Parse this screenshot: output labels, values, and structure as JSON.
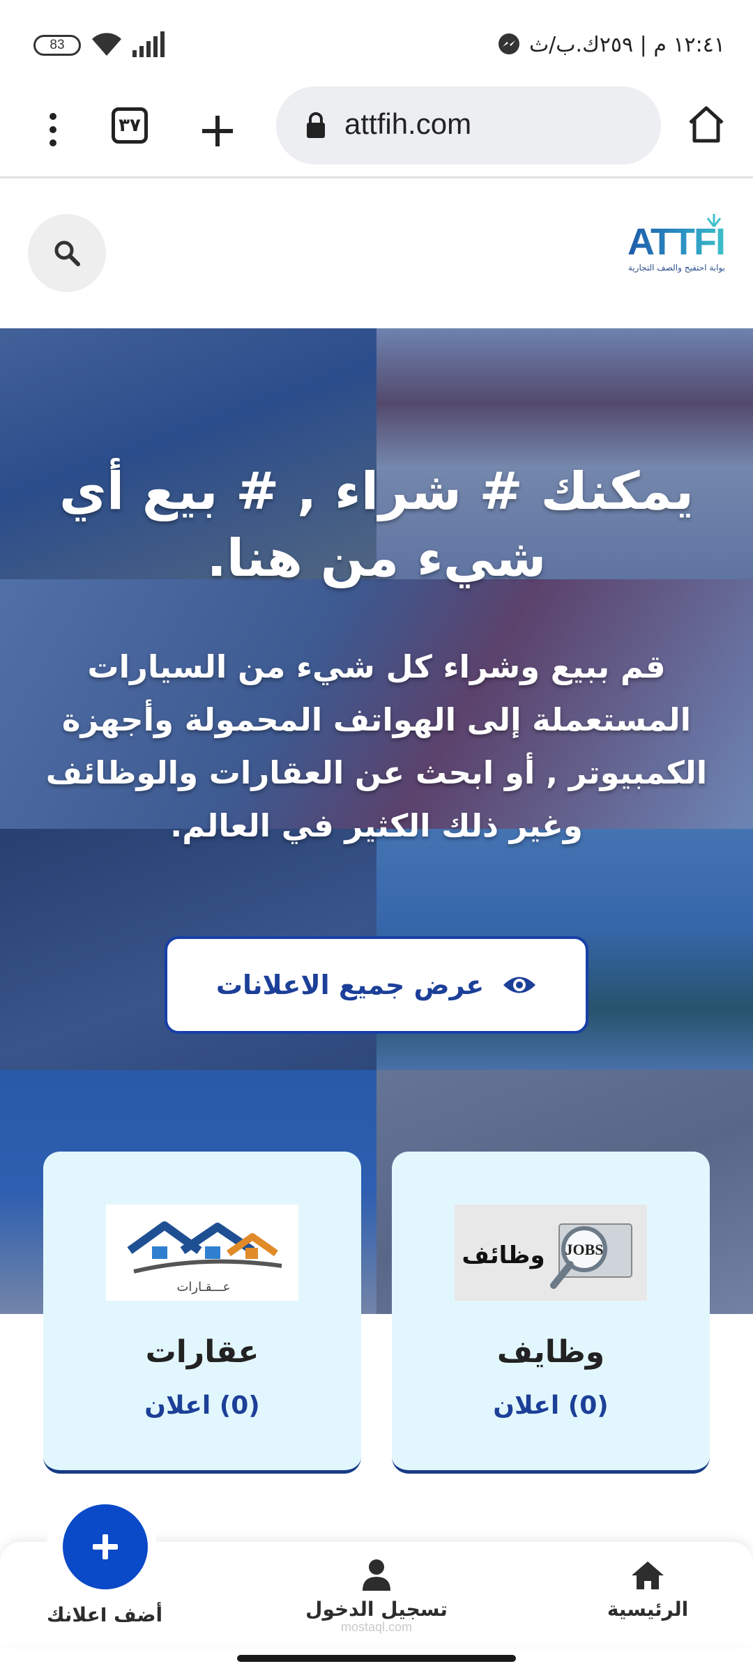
{
  "status_bar": {
    "time_text": "١٢:٤١ م | ٢٥٩ك.ب/ث",
    "battery": "83"
  },
  "browser": {
    "url": "attfih.com",
    "tab_count": "٣٧"
  },
  "site": {
    "logo_text": "ATTFIH",
    "logo_tagline": "بوابة احتفيح والصف التجارية"
  },
  "hero": {
    "title": "يمكنك # شراء , # بيع أي شيء من هنا.",
    "description": "قم ببيع وشراء كل شيء من السيارات المستعملة إلى الهواتف المحمولة وأجهزة الكمبيوتر , أو ابحث عن العقارات والوظائف وغير ذلك الكثير في العالم.",
    "cta_label": "عرض جميع الاعلانات"
  },
  "categories": [
    {
      "name": "وظايف",
      "count": "(0) اعلان",
      "thumb_text": "وظائف",
      "thumb_badge": "JOBS"
    },
    {
      "name": "عقارات",
      "count": "(0) اعلان",
      "thumb_text": "عـــقـارات"
    }
  ],
  "bottom_nav": {
    "home": "الرئيسية",
    "login": "تسجيل الدخول",
    "add": "أضف اعلانك"
  },
  "watermark": "mostaql.com",
  "colors": {
    "primary": "#0a49c7",
    "accent_text": "#1c3f98",
    "card_bg": "#e2f7fd",
    "hero_overlay": "#2348a0"
  }
}
